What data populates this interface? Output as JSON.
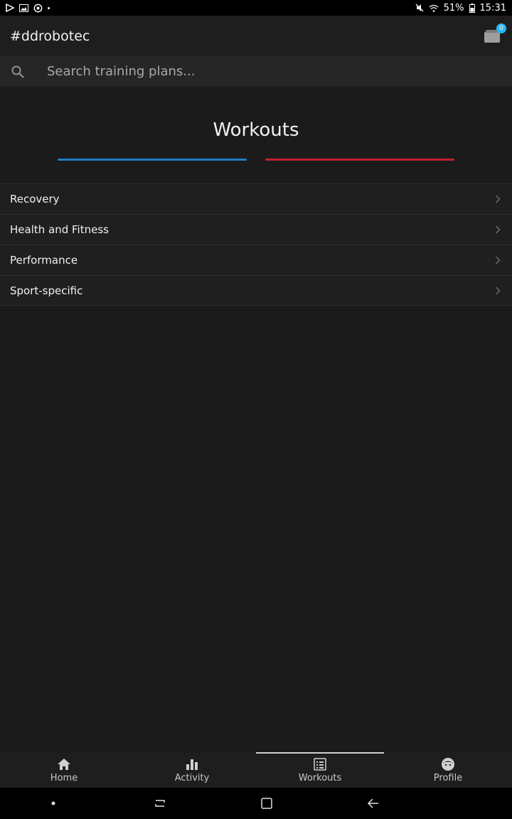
{
  "status_bar": {
    "battery": "51%",
    "time": "15:31"
  },
  "app_bar": {
    "title": "#ddrobotec",
    "inbox_count": "0"
  },
  "search": {
    "placeholder": "Search training plans...",
    "value": ""
  },
  "hero": {
    "title": "Workouts",
    "accent_blue": "#1e7fc0",
    "accent_red": "#c2202f"
  },
  "categories": [
    {
      "label": "Recovery"
    },
    {
      "label": "Health and Fitness"
    },
    {
      "label": "Performance"
    },
    {
      "label": "Sport-specific"
    }
  ],
  "bottom_nav": [
    {
      "label": "Home",
      "icon": "home-icon"
    },
    {
      "label": "Activity",
      "icon": "bar-chart-icon"
    },
    {
      "label": "Workouts",
      "icon": "list-icon",
      "active": true
    },
    {
      "label": "Profile",
      "icon": "face-icon"
    }
  ]
}
